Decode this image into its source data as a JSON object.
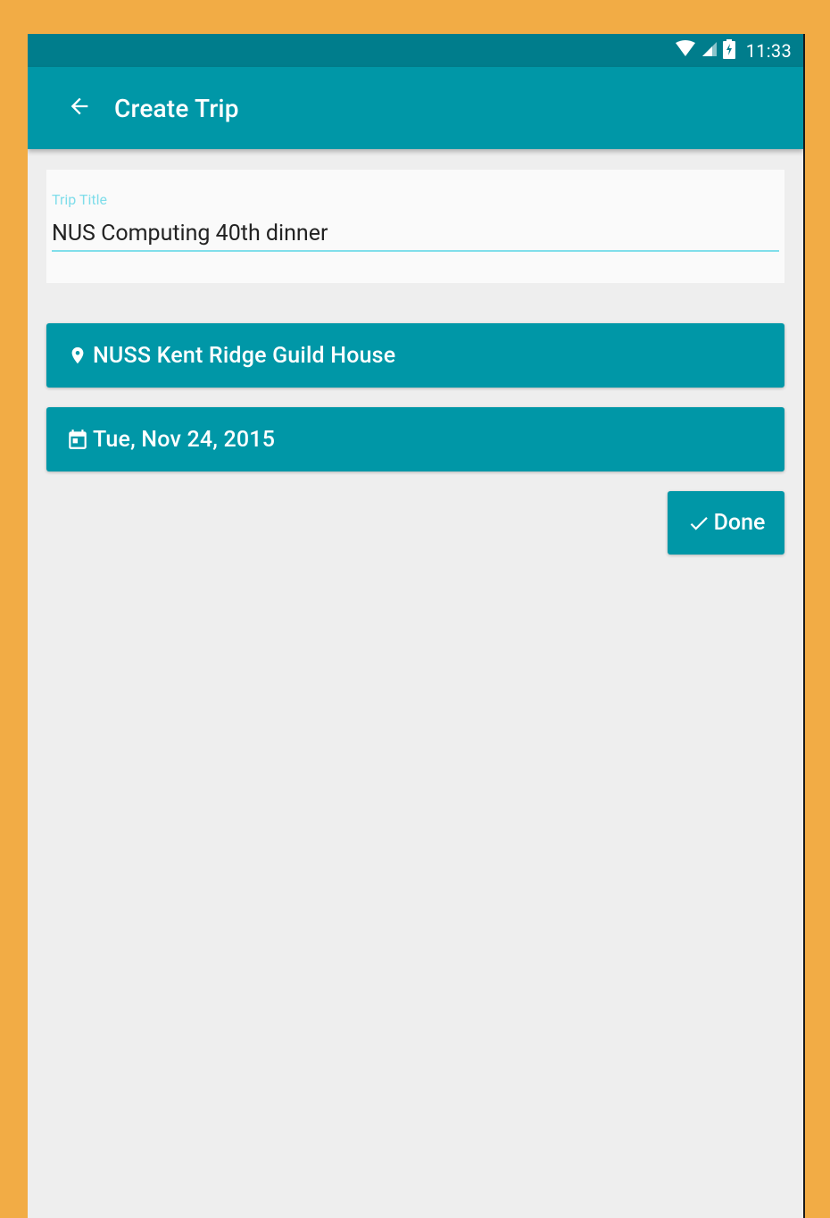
{
  "status_bar": {
    "time": "11:33",
    "icons": [
      "wifi-icon",
      "cell-signal-icon",
      "battery-charging-icon"
    ],
    "color": "#007D8C"
  },
  "app_bar": {
    "title": "Create Trip",
    "back_icon": "arrow-back-icon",
    "color": "#0097A7"
  },
  "form": {
    "trip_title": {
      "label": "Trip Title",
      "value": "NUS Computing 40th dinner"
    },
    "location": {
      "icon": "location-pin-icon",
      "label": "NUSS Kent Ridge Guild House"
    },
    "date": {
      "icon": "calendar-icon",
      "label": "Tue, Nov 24, 2015"
    },
    "done": {
      "icon": "check-icon",
      "label": "Done"
    }
  },
  "colors": {
    "accent": "#0097A7",
    "status_bar": "#007D8C",
    "input_underline": "#80DEEA",
    "background": "#EEEEEE",
    "frame": "#F2AC45"
  }
}
